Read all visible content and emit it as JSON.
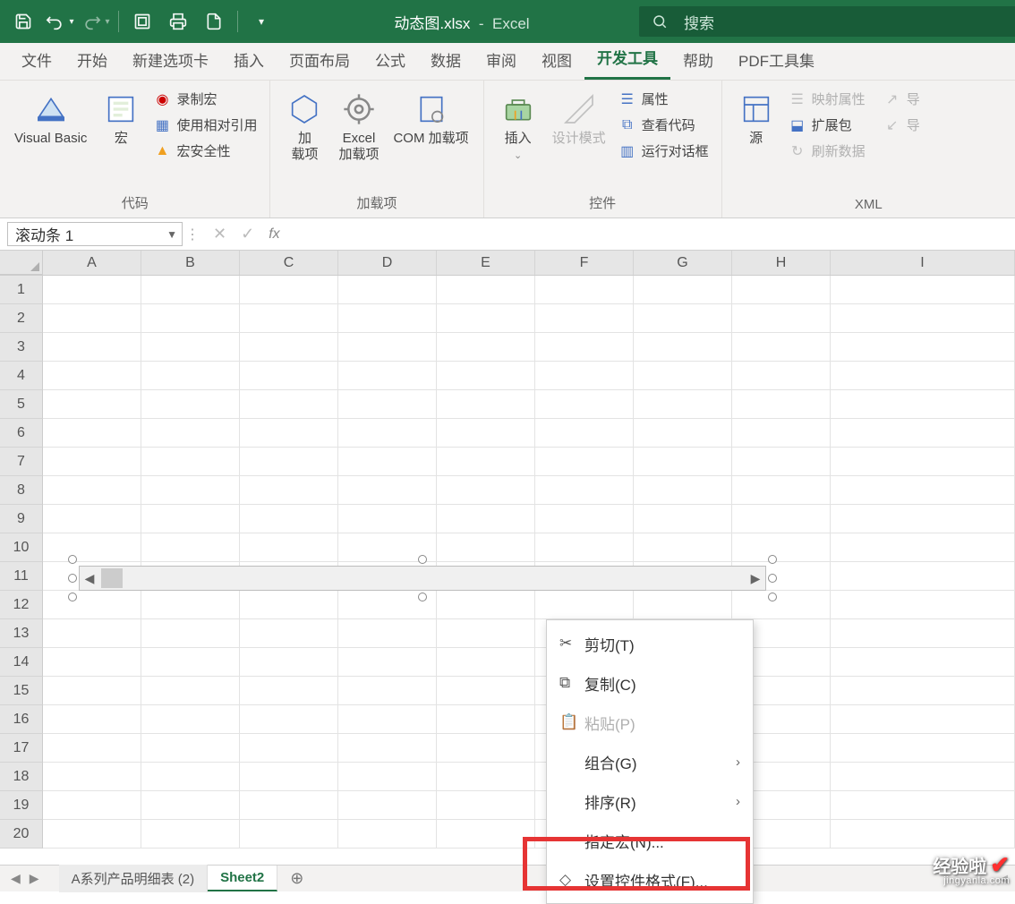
{
  "titlebar": {
    "filename": "动态图.xlsx",
    "app": "Excel",
    "search_placeholder": "搜索"
  },
  "tabs": [
    "文件",
    "开始",
    "新建选项卡",
    "插入",
    "页面布局",
    "公式",
    "数据",
    "审阅",
    "视图",
    "开发工具",
    "帮助",
    "PDF工具集"
  ],
  "active_tab": "开发工具",
  "ribbon": {
    "group_code": {
      "label": "代码",
      "visual_basic": "Visual Basic",
      "macros": "宏",
      "record_macro": "录制宏",
      "relative_ref": "使用相对引用",
      "macro_security": "宏安全性"
    },
    "group_addins": {
      "label": "加载项",
      "addins": "加\n载项",
      "excel_addins": "Excel\n加载项",
      "com_addins": "COM 加载项"
    },
    "group_controls": {
      "label": "控件",
      "insert": "插入",
      "design_mode": "设计模式",
      "properties": "属性",
      "view_code": "查看代码",
      "run_dialog": "运行对话框"
    },
    "group_xml": {
      "label": "XML",
      "source": "源",
      "map_props": "映射属性",
      "expansion": "扩展包",
      "refresh": "刷新数据",
      "export": "导",
      "import": "导"
    }
  },
  "namebox": "滚动条 1",
  "columns": [
    "A",
    "B",
    "C",
    "D",
    "E",
    "F",
    "G",
    "H",
    "I"
  ],
  "rows": [
    1,
    2,
    3,
    4,
    5,
    6,
    7,
    8,
    9,
    10,
    11,
    12,
    13,
    14,
    15,
    16,
    17,
    18,
    19,
    20
  ],
  "context_menu": {
    "cut": "剪切(T)",
    "copy": "复制(C)",
    "paste": "粘贴(P)",
    "group": "组合(G)",
    "order": "排序(R)",
    "assign_macro": "指定宏(N)...",
    "format_control": "设置控件格式(F)..."
  },
  "sheets": {
    "tabs": [
      "A系列产品明细表 (2)",
      "Sheet2"
    ],
    "active": "Sheet2"
  },
  "watermark": {
    "brand": "经验啦",
    "url": "jingyanla.com"
  }
}
